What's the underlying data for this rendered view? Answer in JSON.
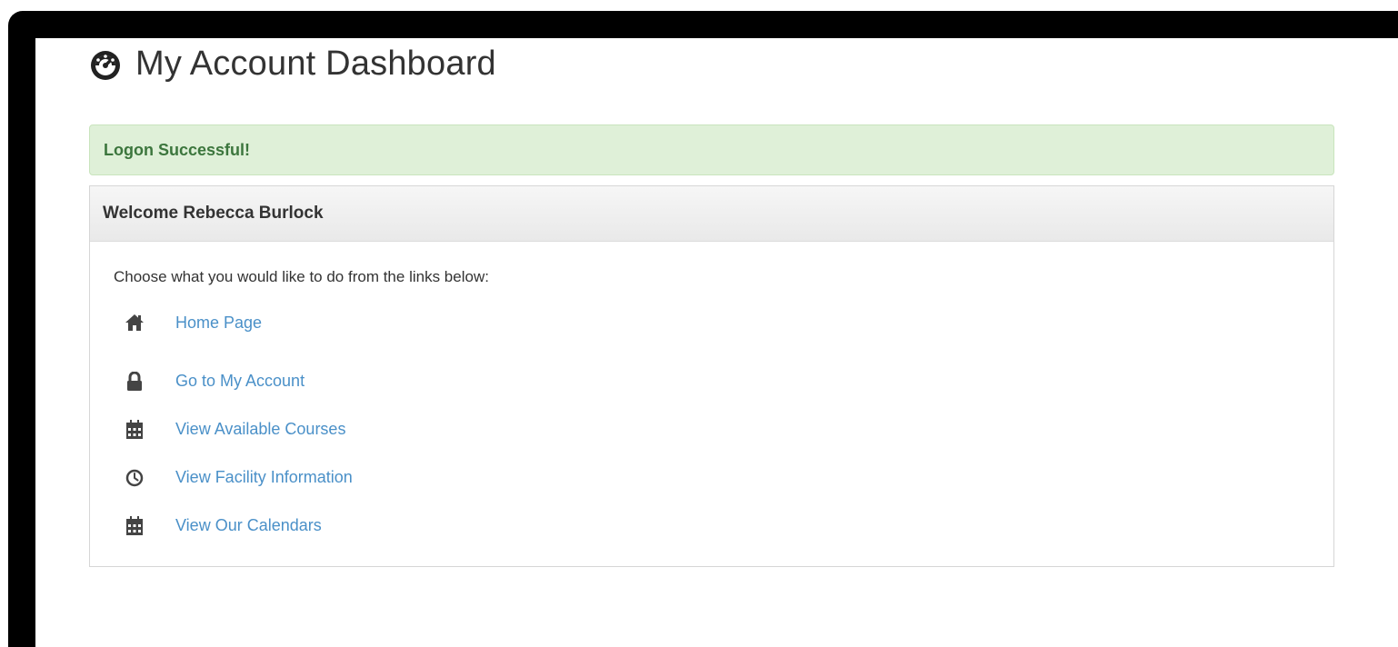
{
  "header": {
    "title": "My Account Dashboard",
    "icon": "dashboard-icon"
  },
  "alert": {
    "message": "Logon Successful!",
    "color": "#dff0d8",
    "text_color": "#3c763d"
  },
  "panel": {
    "heading": "Welcome Rebecca Burlock",
    "intro": "Choose what you would like to do from the links below:",
    "links": [
      {
        "label": "Home Page",
        "icon": "home-icon"
      },
      {
        "label": "Go to My Account",
        "icon": "lock-icon"
      },
      {
        "label": "View Available Courses",
        "icon": "calendar-icon"
      },
      {
        "label": "View Facility Information",
        "icon": "clock-icon"
      },
      {
        "label": "View Our Calendars",
        "icon": "calendar-icon"
      }
    ],
    "link_color": "#4a90c8"
  }
}
